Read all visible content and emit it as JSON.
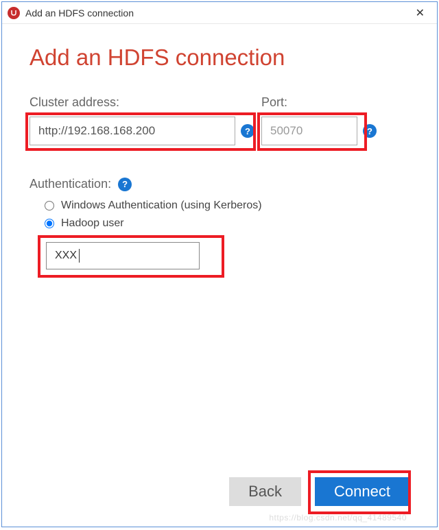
{
  "titlebar": {
    "title": "Add an HDFS connection"
  },
  "heading": "Add an HDFS connection",
  "fields": {
    "cluster": {
      "label": "Cluster address:",
      "value": "http://192.168.168.200"
    },
    "port": {
      "label": "Port:",
      "placeholder": "50070"
    }
  },
  "auth": {
    "label": "Authentication:",
    "options": {
      "windows": "Windows Authentication (using Kerberos)",
      "hadoop": "Hadoop user"
    },
    "selected": "hadoop",
    "user_value": "XXX"
  },
  "buttons": {
    "back": "Back",
    "connect": "Connect"
  },
  "watermark": "https://blog.csdn.net/qq_41489540",
  "icons": {
    "help": "?",
    "close": "✕"
  }
}
